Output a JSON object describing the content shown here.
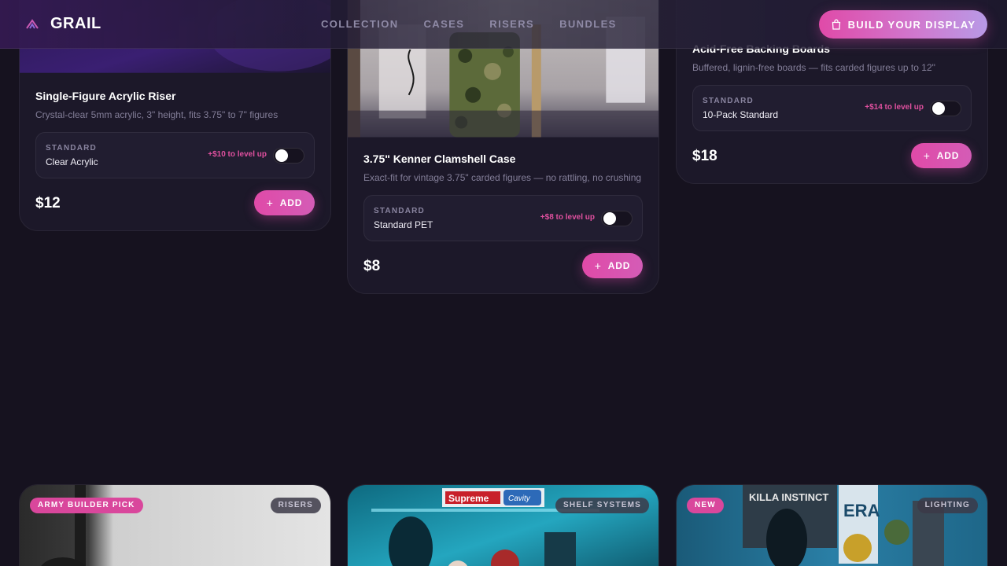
{
  "nav": {
    "brand": "GRAIL",
    "links": [
      "COLLECTION",
      "CASES",
      "RISERS",
      "BUNDLES"
    ],
    "cta": "BUILD YOUR DISPLAY"
  },
  "products": [
    {
      "title": "Single-Figure Acrylic Riser",
      "desc": "Crystal-clear 5mm acrylic, 3\" height, fits 3.75\" to 7\" figures",
      "tier": "STANDARD",
      "option": "Clear Acrylic",
      "level_up": "+$10 to level up",
      "price": "$12",
      "add": "ADD"
    },
    {
      "title": "3.75\" Kenner Clamshell Case",
      "desc": "Exact-fit for vintage 3.75\" carded figures — no rattling, no crushing",
      "tier": "STANDARD",
      "option": "Standard PET",
      "level_up": "+$8 to level up",
      "price": "$8",
      "add": "ADD"
    },
    {
      "title": "Acid-Free Backing Boards",
      "desc": "Buffered, lignin-free boards — fits carded figures up to 12\"",
      "tier": "STANDARD",
      "option": "10-Pack Standard",
      "level_up": "+$14 to level up",
      "price": "$18",
      "add": "ADD"
    }
  ],
  "tiles": [
    {
      "badge": "ARMY BUILDER PICK",
      "category": "RISERS"
    },
    {
      "badge": "",
      "category": "SHELF SYSTEMS",
      "sign_text": "Supreme",
      "sign_text_2": "Cavity"
    },
    {
      "badge": "NEW",
      "category": "LIGHTING",
      "poster_text": "KILLA INSTINCT",
      "poster_text_2": "ERA"
    }
  ],
  "colors": {
    "background": "#16121f",
    "card": "#1c1829",
    "accent_pink": "#e04aa8",
    "accent_lavender": "#b89ae6"
  },
  "icons": [
    "grail-logo-icon",
    "shopping-bag-icon",
    "plus-icon"
  ]
}
